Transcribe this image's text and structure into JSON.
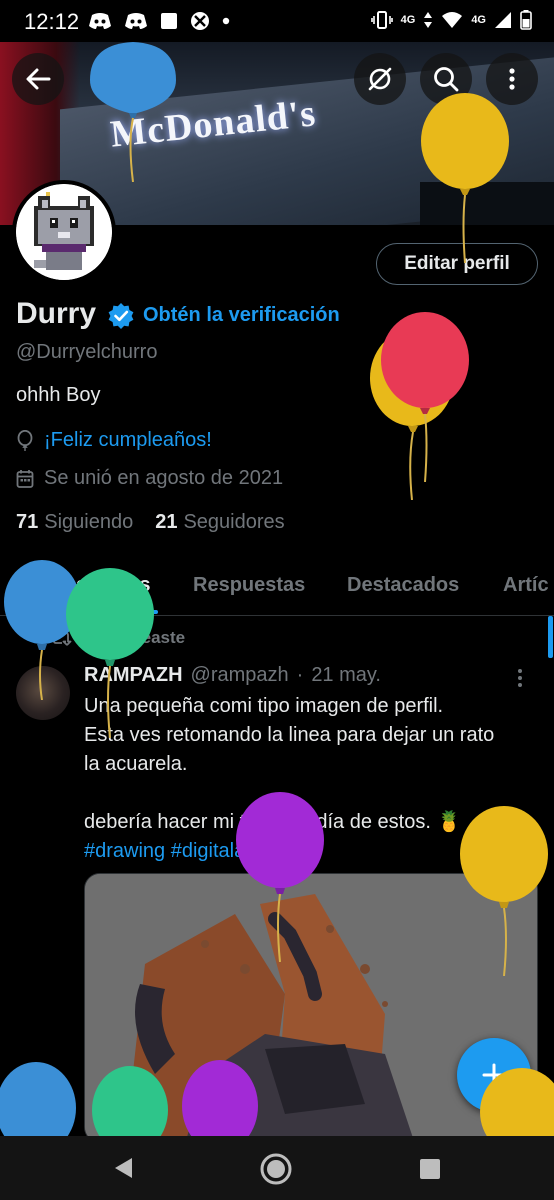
{
  "status_bar": {
    "time": "12:12",
    "network_small_1": "4G",
    "network_small_2": "4G",
    "icons": [
      "discord-icon",
      "discord-icon",
      "square-icon",
      "xbox-icon",
      "dot-icon",
      "vibrate-icon",
      "data-arrows-icon",
      "wifi-icon",
      "signal-icon",
      "battery-icon"
    ]
  },
  "banner": {
    "sign_text": "McDonald's"
  },
  "header_buttons": {
    "back": "back-arrow-icon",
    "hide": "eye-slash-icon",
    "search": "search-icon",
    "more": "more-vertical-icon"
  },
  "profile": {
    "edit_button": "Editar perfil",
    "display_name": "Durry",
    "get_verified": "Obtén la verificación",
    "handle": "@Durryelchurro",
    "bio": "ohhh Boy",
    "birthday": "¡Feliz cumpleaños!",
    "joined": "Se unió en agosto de 2021",
    "following_count": "71",
    "following_label": "Siguiendo",
    "followers_count": "21",
    "followers_label": "Seguidores"
  },
  "tabs": [
    {
      "label": "Publicaciones",
      "active": true
    },
    {
      "label": "Respuestas",
      "active": false
    },
    {
      "label": "Destacados",
      "active": false
    },
    {
      "label": "Artíc",
      "active": false
    }
  ],
  "post": {
    "repost_label": "Reposteaste",
    "author_name": "RAMPAZH",
    "author_handle": "@rampazh",
    "separator": "·",
    "date": "21 may.",
    "text_lines": [
      "Una pequeña comi tipo imagen de perfil.",
      "Esta ves retomando la linea para dejar un rato",
      "la acuarela.",
      "",
      "debería hacer mi tabla un día de estos. 🍍"
    ],
    "hashtags": [
      "#drawing",
      "#digitalart"
    ]
  },
  "fab": {
    "icon": "plus-icon"
  },
  "nav_bar": {
    "back": "nav-back-icon",
    "home": "nav-home-icon",
    "recents": "nav-recents-icon"
  },
  "colors": {
    "accent": "#1d9bf0",
    "text_primary": "#e7e9ea",
    "text_secondary": "#71767b",
    "background": "#000000",
    "balloon_blue": "#3b8fd6",
    "balloon_yellow": "#e8b91a",
    "balloon_red": "#e83a55",
    "balloon_green": "#2ec58a",
    "balloon_purple": "#a22ad6"
  }
}
